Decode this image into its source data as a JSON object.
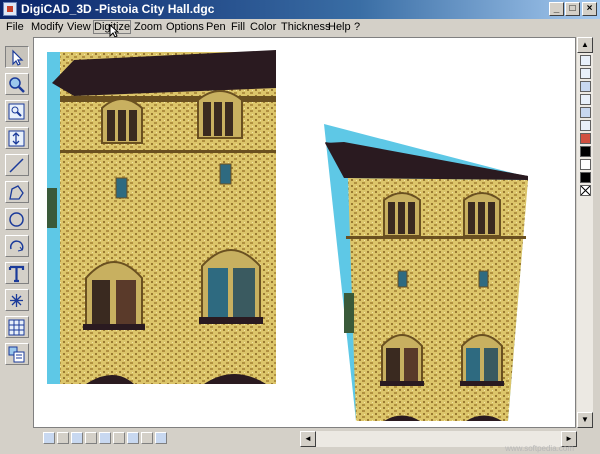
{
  "window": {
    "title": "DigiCAD_3D -Pistoia City Hall.dgc"
  },
  "caption_buttons": {
    "minimize": "_",
    "maximize": "□",
    "close": "×"
  },
  "menu": [
    {
      "label": "File"
    },
    {
      "label": "Modify"
    },
    {
      "label": "View"
    },
    {
      "label": "Digitize"
    },
    {
      "label": "Zoom"
    },
    {
      "label": "Options"
    },
    {
      "label": "Pen"
    },
    {
      "label": "Fill"
    },
    {
      "label": "Color"
    },
    {
      "label": "Thickness"
    },
    {
      "label": "Help"
    },
    {
      "label": "?"
    }
  ],
  "active_menu": "Digitize",
  "tools": [
    {
      "name": "select-arrow-icon"
    },
    {
      "name": "magnifier-icon"
    },
    {
      "name": "rectangle-zoom-icon"
    },
    {
      "name": "vertical-pan-icon"
    },
    {
      "name": "line-tool-icon"
    },
    {
      "name": "polygon-tool-icon"
    },
    {
      "name": "circle-tool-icon"
    },
    {
      "name": "arc-tool-icon"
    },
    {
      "name": "text-tool-icon"
    },
    {
      "name": "point-star-icon"
    },
    {
      "name": "grid-table-icon"
    },
    {
      "name": "layers-icon"
    }
  ],
  "colors": {
    "canvas": "#ffffff",
    "sky": "#5ec8e6",
    "stone_light": "#e6d27a",
    "stone_dark": "#8a6a2c",
    "roof": "#2a1a20"
  },
  "watermark": "www.softpedia.com"
}
